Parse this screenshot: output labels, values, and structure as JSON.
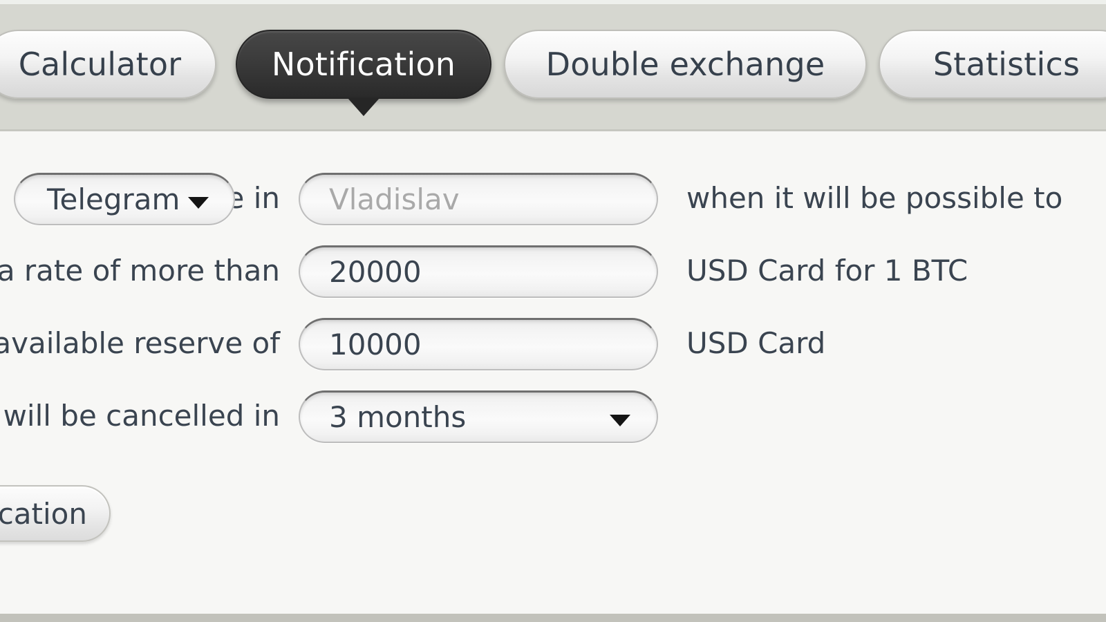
{
  "tabs": [
    {
      "id": "calculator",
      "label": "Calculator",
      "active": false
    },
    {
      "id": "notification",
      "label": "Notification",
      "active": true
    },
    {
      "id": "double",
      "label": "Double exchange",
      "active": false
    },
    {
      "id": "statistics",
      "label": "Statistics",
      "active": false
    }
  ],
  "form": {
    "rows": [
      {
        "lead_label": "Notify me in",
        "control": "select-channel",
        "value": "Telegram",
        "trail_label": "when it will be possible to"
      },
      {
        "lead_label": "exchange BTC at a rate of more than",
        "control": "input-amount",
        "value": "20000",
        "trail_label": "USD Card for 1 BTC"
      },
      {
        "lead_label": "and with an available reserve of",
        "control": "input-reserve",
        "value": "10000",
        "trail_label": "USD Card"
      },
      {
        "lead_label": "This notification will be cancelled in",
        "control": "select-period",
        "value": "3 months",
        "trail_label": ""
      }
    ],
    "username_placeholder": "Vladislav",
    "username_value": ""
  },
  "submit": {
    "label": "Add notification"
  },
  "icons": {
    "caret_down": "chevron-down-icon"
  },
  "colors": {
    "tabbar_bg": "#d6d7d0",
    "content_bg": "#f7f7f5",
    "active_tab_bg": "#3b3b3b",
    "text": "#3a4450",
    "placeholder": "#a9a9a9",
    "bottom_strip": "#c2c2bb"
  }
}
